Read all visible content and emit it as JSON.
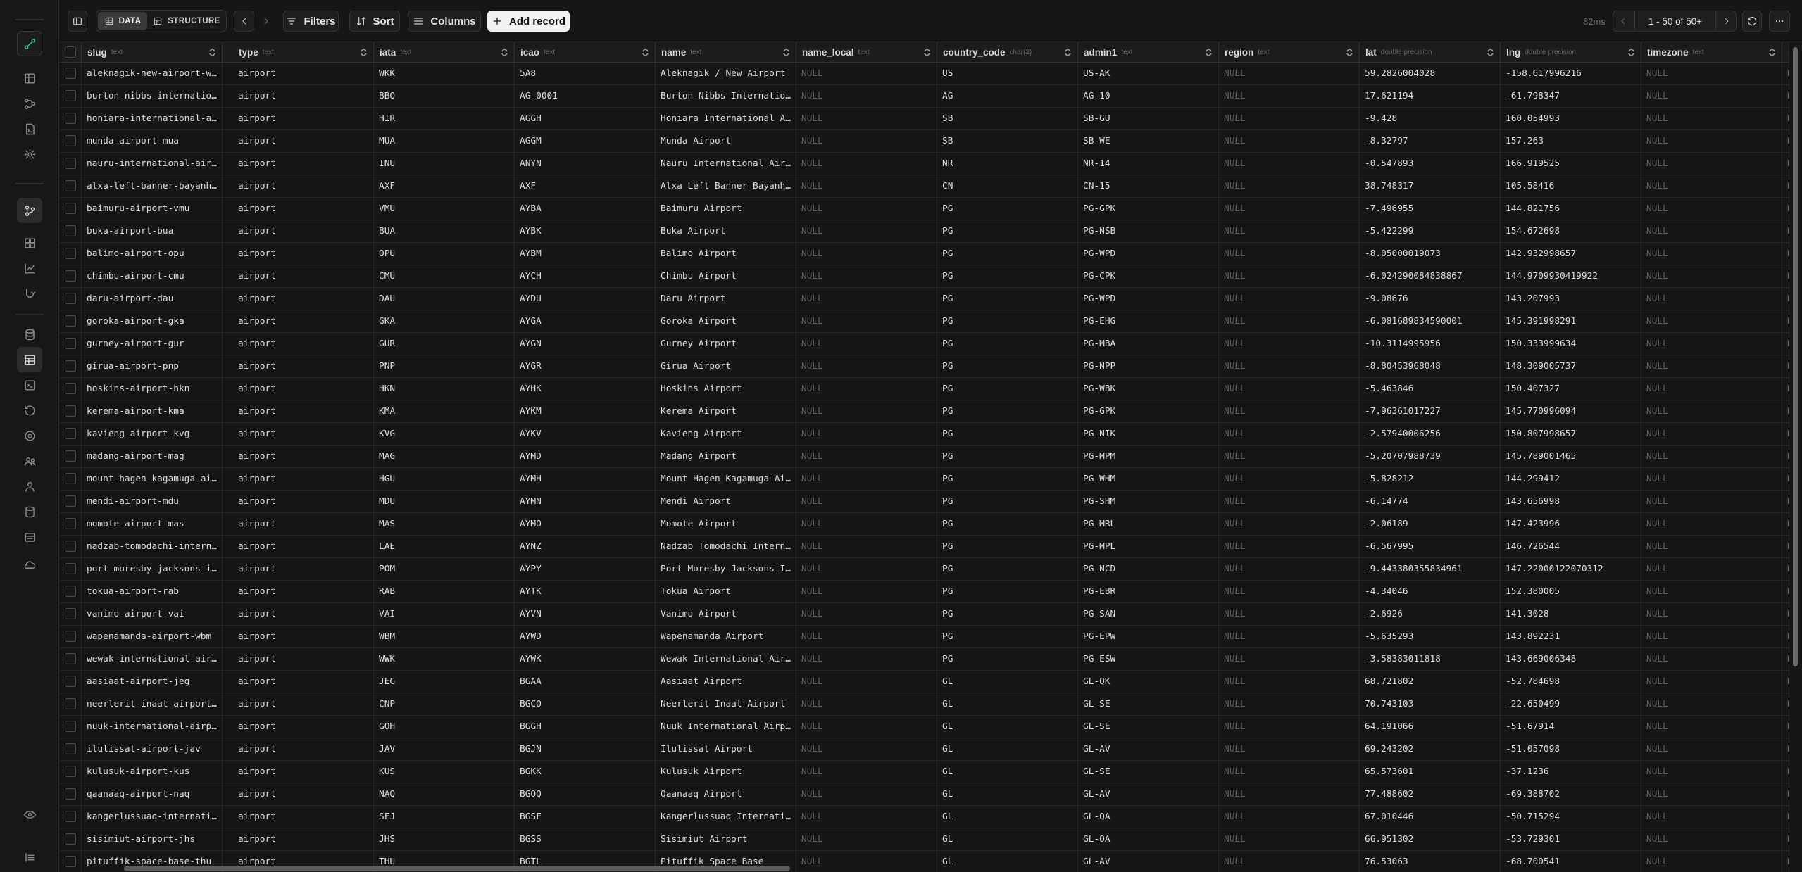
{
  "sidebar": {
    "top_icons": [
      "link-icon",
      "table-icon",
      "branch-icon",
      "sql-icon",
      "settings-icon"
    ],
    "mid_icons": [
      "branch-icon",
      "dashboard-icon",
      "chart-icon",
      "hook-icon"
    ],
    "lower_icons": [
      "database-icon",
      "table-editor-icon",
      "sql-editor-icon",
      "history-icon",
      "globe-icon",
      "users-icon",
      "user-icon",
      "storage-icon",
      "backups-icon",
      "cloud-icon"
    ],
    "bottom_icons": [
      "help-icon",
      "collapse-sidebar-icon"
    ]
  },
  "toolbar": {
    "view_data_label": "DATA",
    "view_structure_label": "STRUCTURE",
    "filters_label": "Filters",
    "sort_label": "Sort",
    "columns_label": "Columns",
    "add_record_label": "Add record",
    "timing": "82ms",
    "pagination": "1 - 50 of 50+"
  },
  "table": {
    "columns": [
      {
        "name": "slug",
        "type": "text"
      },
      {
        "name": "type",
        "type": "text"
      },
      {
        "name": "iata",
        "type": "text"
      },
      {
        "name": "icao",
        "type": "text"
      },
      {
        "name": "name",
        "type": "text"
      },
      {
        "name": "name_local",
        "type": "text"
      },
      {
        "name": "country_code",
        "type": "char(2)"
      },
      {
        "name": "admin1",
        "type": "text"
      },
      {
        "name": "region",
        "type": "text"
      },
      {
        "name": "lat",
        "type": "double precision"
      },
      {
        "name": "lng",
        "type": "double precision"
      },
      {
        "name": "timezone",
        "type": "text"
      },
      {
        "name": "po",
        "type": ""
      }
    ],
    "rows": [
      [
        "aleknagik-new-airport-wkk",
        "airport",
        "WKK",
        "5A8",
        "Aleknagik / New Airport",
        "NULL",
        "US",
        "US-AK",
        "NULL",
        "59.2826004028",
        "-158.617996216",
        "NULL",
        "NU"
      ],
      [
        "burton-nibbs-international-airport-bbq",
        "airport",
        "BBQ",
        "AG-0001",
        "Burton-Nibbs International Airport",
        "NULL",
        "AG",
        "AG-10",
        "NULL",
        "17.621194",
        "-61.798347",
        "NULL",
        "NU"
      ],
      [
        "honiara-international-airport-hir",
        "airport",
        "HIR",
        "AGGH",
        "Honiara International Airport",
        "NULL",
        "SB",
        "SB-GU",
        "NULL",
        "-9.428",
        "160.054993",
        "NULL",
        "NU"
      ],
      [
        "munda-airport-mua",
        "airport",
        "MUA",
        "AGGM",
        "Munda Airport",
        "NULL",
        "SB",
        "SB-WE",
        "NULL",
        "-8.32797",
        "157.263",
        "NULL",
        "NU"
      ],
      [
        "nauru-international-airport-inu",
        "airport",
        "INU",
        "ANYN",
        "Nauru International Airport",
        "NULL",
        "NR",
        "NR-14",
        "NULL",
        "-0.547893",
        "166.919525",
        "NULL",
        "NU"
      ],
      [
        "alxa-left-banner-bayanhot-airport-axf",
        "airport",
        "AXF",
        "AXF",
        "Alxa Left Banner Bayanhot Airport",
        "NULL",
        "CN",
        "CN-15",
        "NULL",
        "38.748317",
        "105.58416",
        "NULL",
        "NU"
      ],
      [
        "baimuru-airport-vmu",
        "airport",
        "VMU",
        "AYBA",
        "Baimuru Airport",
        "NULL",
        "PG",
        "PG-GPK",
        "NULL",
        "-7.496955",
        "144.821756",
        "NULL",
        "NU"
      ],
      [
        "buka-airport-bua",
        "airport",
        "BUA",
        "AYBK",
        "Buka Airport",
        "NULL",
        "PG",
        "PG-NSB",
        "NULL",
        "-5.422299",
        "154.672698",
        "NULL",
        "NU"
      ],
      [
        "balimo-airport-opu",
        "airport",
        "OPU",
        "AYBM",
        "Balimo Airport",
        "NULL",
        "PG",
        "PG-WPD",
        "NULL",
        "-8.05000019073",
        "142.932998657",
        "NULL",
        "NU"
      ],
      [
        "chimbu-airport-cmu",
        "airport",
        "CMU",
        "AYCH",
        "Chimbu Airport",
        "NULL",
        "PG",
        "PG-CPK",
        "NULL",
        "-6.024290084838867",
        "144.9709930419922",
        "NULL",
        "NU"
      ],
      [
        "daru-airport-dau",
        "airport",
        "DAU",
        "AYDU",
        "Daru Airport",
        "NULL",
        "PG",
        "PG-WPD",
        "NULL",
        "-9.08676",
        "143.207993",
        "NULL",
        "NU"
      ],
      [
        "goroka-airport-gka",
        "airport",
        "GKA",
        "AYGA",
        "Goroka Airport",
        "NULL",
        "PG",
        "PG-EHG",
        "NULL",
        "-6.081689834590001",
        "145.391998291",
        "NULL",
        "NU"
      ],
      [
        "gurney-airport-gur",
        "airport",
        "GUR",
        "AYGN",
        "Gurney Airport",
        "NULL",
        "PG",
        "PG-MBA",
        "NULL",
        "-10.3114995956",
        "150.333999634",
        "NULL",
        "NU"
      ],
      [
        "girua-airport-pnp",
        "airport",
        "PNP",
        "AYGR",
        "Girua Airport",
        "NULL",
        "PG",
        "PG-NPP",
        "NULL",
        "-8.80453968048",
        "148.309005737",
        "NULL",
        "NU"
      ],
      [
        "hoskins-airport-hkn",
        "airport",
        "HKN",
        "AYHK",
        "Hoskins Airport",
        "NULL",
        "PG",
        "PG-WBK",
        "NULL",
        "-5.463846",
        "150.407327",
        "NULL",
        "NU"
      ],
      [
        "kerema-airport-kma",
        "airport",
        "KMA",
        "AYKM",
        "Kerema Airport",
        "NULL",
        "PG",
        "PG-GPK",
        "NULL",
        "-7.96361017227",
        "145.770996094",
        "NULL",
        "NU"
      ],
      [
        "kavieng-airport-kvg",
        "airport",
        "KVG",
        "AYKV",
        "Kavieng Airport",
        "NULL",
        "PG",
        "PG-NIK",
        "NULL",
        "-2.57940006256",
        "150.807998657",
        "NULL",
        "NU"
      ],
      [
        "madang-airport-mag",
        "airport",
        "MAG",
        "AYMD",
        "Madang Airport",
        "NULL",
        "PG",
        "PG-MPM",
        "NULL",
        "-5.20707988739",
        "145.789001465",
        "NULL",
        "NU"
      ],
      [
        "mount-hagen-kagamuga-airport-hgu",
        "airport",
        "HGU",
        "AYMH",
        "Mount Hagen Kagamuga Airport",
        "NULL",
        "PG",
        "PG-WHM",
        "NULL",
        "-5.828212",
        "144.299412",
        "NULL",
        "NU"
      ],
      [
        "mendi-airport-mdu",
        "airport",
        "MDU",
        "AYMN",
        "Mendi Airport",
        "NULL",
        "PG",
        "PG-SHM",
        "NULL",
        "-6.14774",
        "143.656998",
        "NULL",
        "NU"
      ],
      [
        "momote-airport-mas",
        "airport",
        "MAS",
        "AYMO",
        "Momote Airport",
        "NULL",
        "PG",
        "PG-MRL",
        "NULL",
        "-2.06189",
        "147.423996",
        "NULL",
        "NU"
      ],
      [
        "nadzab-tomodachi-international-airport-lae",
        "airport",
        "LAE",
        "AYNZ",
        "Nadzab Tomodachi International Airport",
        "NULL",
        "PG",
        "PG-MPL",
        "NULL",
        "-6.567995",
        "146.726544",
        "NULL",
        "NU"
      ],
      [
        "port-moresby-jacksons-international-airport-pom",
        "airport",
        "POM",
        "AYPY",
        "Port Moresby Jacksons International Airport",
        "NULL",
        "PG",
        "PG-NCD",
        "NULL",
        "-9.443380355834961",
        "147.22000122070312",
        "NULL",
        "NU"
      ],
      [
        "tokua-airport-rab",
        "airport",
        "RAB",
        "AYTK",
        "Tokua Airport",
        "NULL",
        "PG",
        "PG-EBR",
        "NULL",
        "-4.34046",
        "152.380005",
        "NULL",
        "NU"
      ],
      [
        "vanimo-airport-vai",
        "airport",
        "VAI",
        "AYVN",
        "Vanimo Airport",
        "NULL",
        "PG",
        "PG-SAN",
        "NULL",
        "-2.6926",
        "141.3028",
        "NULL",
        "NU"
      ],
      [
        "wapenamanda-airport-wbm",
        "airport",
        "WBM",
        "AYWD",
        "Wapenamanda Airport",
        "NULL",
        "PG",
        "PG-EPW",
        "NULL",
        "-5.635293",
        "143.892231",
        "NULL",
        "NU"
      ],
      [
        "wewak-international-airport-wwk",
        "airport",
        "WWK",
        "AYWK",
        "Wewak International Airport",
        "NULL",
        "PG",
        "PG-ESW",
        "NULL",
        "-3.58383011818",
        "143.669006348",
        "NULL",
        "NU"
      ],
      [
        "aasiaat-airport-jeg",
        "airport",
        "JEG",
        "BGAA",
        "Aasiaat Airport",
        "NULL",
        "GL",
        "GL-QK",
        "NULL",
        "68.721802",
        "-52.784698",
        "NULL",
        "NU"
      ],
      [
        "neerlerit-inaat-airport-cnp",
        "airport",
        "CNP",
        "BGCO",
        "Neerlerit Inaat Airport",
        "NULL",
        "GL",
        "GL-SE",
        "NULL",
        "70.743103",
        "-22.650499",
        "NULL",
        "NU"
      ],
      [
        "nuuk-international-airport-goh",
        "airport",
        "GOH",
        "BGGH",
        "Nuuk International Airport",
        "NULL",
        "GL",
        "GL-SE",
        "NULL",
        "64.191066",
        "-51.67914",
        "NULL",
        "NU"
      ],
      [
        "ilulissat-airport-jav",
        "airport",
        "JAV",
        "BGJN",
        "Ilulissat Airport",
        "NULL",
        "GL",
        "GL-AV",
        "NULL",
        "69.243202",
        "-51.057098",
        "NULL",
        "NU"
      ],
      [
        "kulusuk-airport-kus",
        "airport",
        "KUS",
        "BGKK",
        "Kulusuk Airport",
        "NULL",
        "GL",
        "GL-SE",
        "NULL",
        "65.573601",
        "-37.1236",
        "NULL",
        "NU"
      ],
      [
        "qaanaaq-airport-naq",
        "airport",
        "NAQ",
        "BGQQ",
        "Qaanaaq Airport",
        "NULL",
        "GL",
        "GL-AV",
        "NULL",
        "77.488602",
        "-69.388702",
        "NULL",
        "NU"
      ],
      [
        "kangerlussuaq-international-airport-sfj",
        "airport",
        "SFJ",
        "BGSF",
        "Kangerlussuaq International Airport",
        "NULL",
        "GL",
        "GL-QA",
        "NULL",
        "67.010446",
        "-50.715294",
        "NULL",
        "NU"
      ],
      [
        "sisimiut-airport-jhs",
        "airport",
        "JHS",
        "BGSS",
        "Sisimiut Airport",
        "NULL",
        "GL",
        "GL-QA",
        "NULL",
        "66.951302",
        "-53.729301",
        "NULL",
        "NU"
      ],
      [
        "pituffik-space-base-thu",
        "airport",
        "THU",
        "BGTL",
        "Pituffik Space Base",
        "NULL",
        "GL",
        "GL-AV",
        "NULL",
        "76.53063",
        "-68.700541",
        "NULL",
        "NU"
      ]
    ]
  }
}
